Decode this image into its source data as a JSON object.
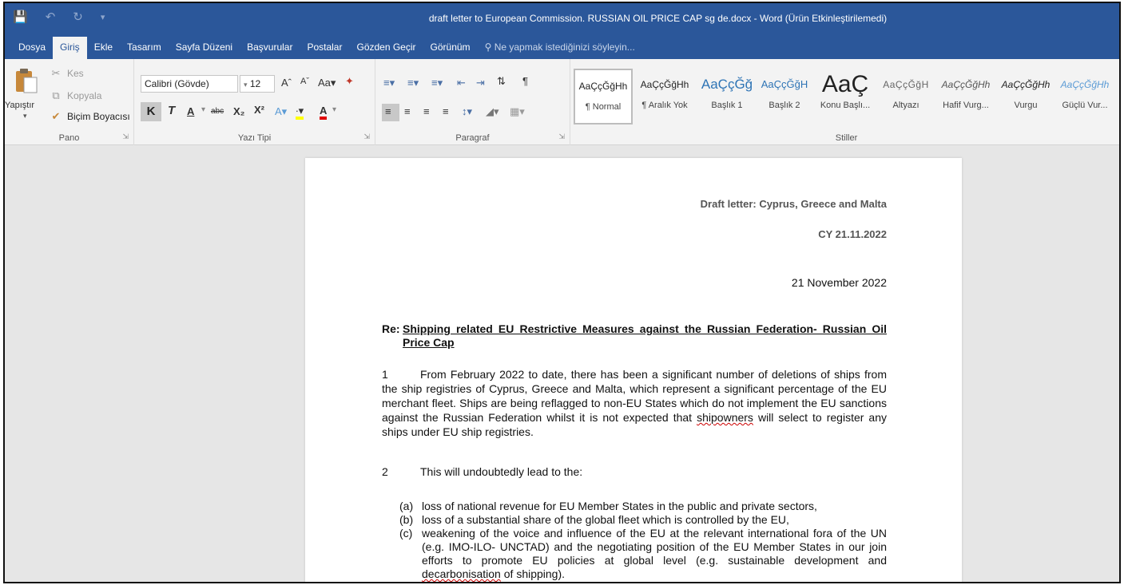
{
  "window": {
    "title": "draft letter to European Commission. RUSSIAN OIL PRICE CAP sg de.docx - Word (Ürün Etkinleştirilemedi)"
  },
  "quick_access": {
    "save_icon": "save-icon",
    "undo_icon": "undo-icon",
    "redo_icon": "redo-icon",
    "customize_icon": "customize-qat-icon"
  },
  "tabs": [
    "Dosya",
    "Giriş",
    "Ekle",
    "Tasarım",
    "Sayfa Düzeni",
    "Başvurular",
    "Postalar",
    "Gözden Geçir",
    "Görünüm"
  ],
  "active_tab": "Giriş",
  "tell_me": "Ne yapmak istediğinizi söyleyin...",
  "ribbon": {
    "clipboard": {
      "label": "Pano",
      "paste": "Yapıştır",
      "cut": "Kes",
      "copy": "Kopyala",
      "format_painter": "Biçim Boyacısı"
    },
    "font": {
      "label": "Yazı Tipi",
      "font_name": "Calibri (Gövde)",
      "font_size": "12",
      "bold": "K",
      "italic": "T",
      "underline": "A",
      "strike": "abc"
    },
    "paragraph": {
      "label": "Paragraf"
    },
    "styles": {
      "label": "Stiller",
      "items": [
        {
          "sample": "AaÇçĞğHh",
          "name": "¶ Normal"
        },
        {
          "sample": "AaÇçĞğHh",
          "name": "¶ Aralık Yok"
        },
        {
          "sample": "AaÇçĞğ",
          "name": "Başlık 1"
        },
        {
          "sample": "AaÇçĞğH",
          "name": "Başlık 2"
        },
        {
          "sample": "AaÇ",
          "name": "Konu Başlı..."
        },
        {
          "sample": "AaÇçĞğH",
          "name": "Altyazı"
        },
        {
          "sample": "AaÇçĞğHh",
          "name": "Hafif Vurg..."
        },
        {
          "sample": "AaÇçĞğHh",
          "name": "Vurgu"
        },
        {
          "sample": "AaÇçĞğHh",
          "name": "Güçlü Vur..."
        }
      ]
    }
  },
  "document": {
    "header_line1": "Draft letter: Cyprus, Greece and Malta",
    "header_line2": "CY 21.11.2022",
    "date": "21 November 2022",
    "re_label": "Re:",
    "re_text": "Shipping related EU Restrictive Measures against the Russian Federation- Russian Oil Price Cap",
    "p1_num": "1",
    "p1_text_a": "From February 2022 to date, there has been a significant number of deletions of ships from the ship registries of Cyprus, Greece and Malta, which represent a significant percentage of the EU merchant fleet.  Ships are being reflagged to non-EU States which do not implement the EU sanctions against the Russian Federation whilst it is not expected that ",
    "p1_squig": "shipowners",
    "p1_text_b": " will select to register any ships under EU ship registries.",
    "p2_num": "2",
    "p2_text": "This will undoubtedly lead to the:",
    "list": [
      {
        "mark": "(a)",
        "text": "loss of national revenue for EU Member States in the public and private sectors,"
      },
      {
        "mark": "(b)",
        "text": "loss of a substantial share of the global fleet which is controlled by the EU,"
      },
      {
        "mark": "(c)",
        "text_a": "weakening of the voice and influence of the EU at the relevant international fora of the UN (e.g. IMO-ILO- UNCTAD) and the negotiating position of the EU Member States in our join efforts to promote EU policies at global level (e.g. sustainable development and ",
        "squig": "decarbonisation",
        "text_b": " of shipping)."
      }
    ]
  },
  "colors": {
    "word_blue": "#2b579a",
    "ribbon_bg": "#f3f3f3",
    "workspace_bg": "#e6e6e6"
  }
}
